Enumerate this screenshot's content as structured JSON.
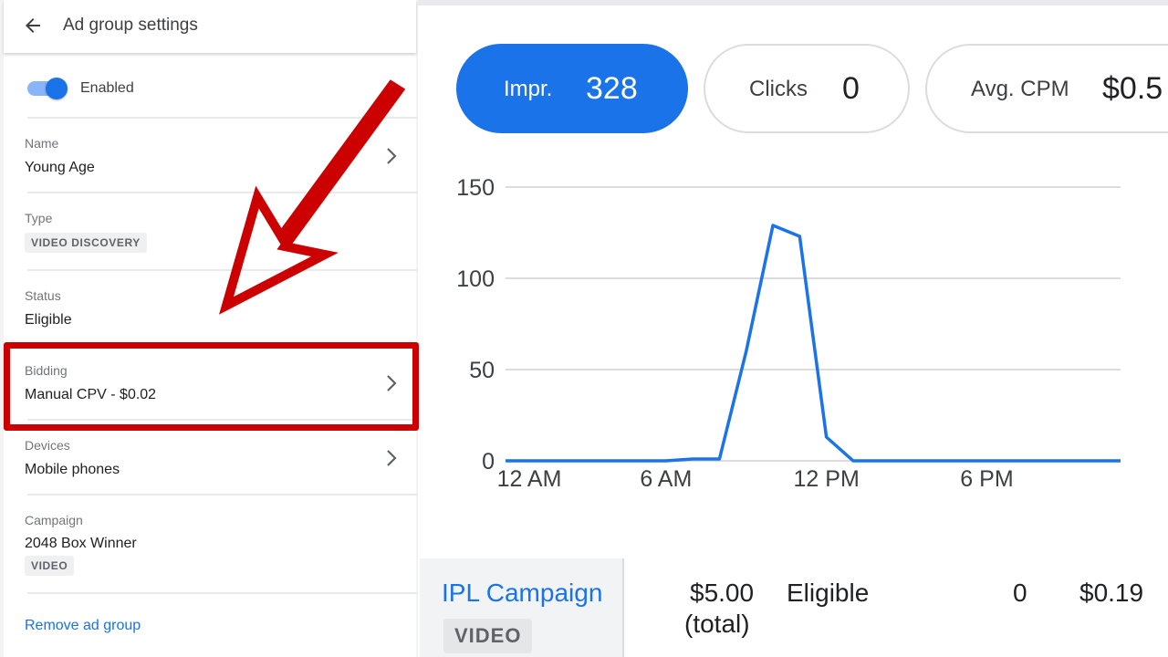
{
  "header": {
    "title": "Ad group settings",
    "back_icon": "arrow-back-icon"
  },
  "status_toggle": {
    "label": "Enabled",
    "on": true
  },
  "fields": {
    "name": {
      "label": "Name",
      "value": "Young Age"
    },
    "type": {
      "label": "Type",
      "chip": "VIDEO DISCOVERY"
    },
    "status": {
      "label": "Status",
      "value": "Eligible"
    },
    "bidding": {
      "label": "Bidding",
      "value": "Manual CPV - $0.02"
    },
    "devices": {
      "label": "Devices",
      "value": "Mobile phones"
    },
    "campaign": {
      "label": "Campaign",
      "value": "2048 Box Winner",
      "chip": "VIDEO"
    }
  },
  "remove_link": "Remove ad group",
  "metrics": [
    {
      "label": "Impr.",
      "value": "328",
      "active": true
    },
    {
      "label": "Clicks",
      "value": "0",
      "active": false
    },
    {
      "label": "Avg. CPM",
      "value": "$0.5",
      "active": false
    }
  ],
  "chart_data": {
    "type": "line",
    "title": "",
    "xlabel": "",
    "ylabel": "",
    "x_ticks": [
      "12 AM",
      "6 AM",
      "12 PM",
      "6 PM"
    ],
    "y_ticks": [
      0,
      50,
      100,
      150
    ],
    "ylim": [
      0,
      150
    ],
    "xlim": [
      0,
      23
    ],
    "grid": true,
    "series": [
      {
        "x": [
          0,
          1,
          2,
          3,
          4,
          5,
          6,
          7,
          8,
          9,
          10,
          11,
          12,
          13,
          14,
          15,
          16,
          17,
          18,
          19,
          20,
          21,
          22,
          23
        ],
        "y": [
          0,
          0,
          0,
          0,
          0,
          0,
          0,
          1,
          1,
          60,
          129,
          123,
          13,
          0,
          0,
          0,
          0,
          0,
          0,
          0,
          0,
          0,
          0,
          0
        ]
      }
    ],
    "colors": {
      "line": "#1a73e8",
      "grid": "#dadce0"
    }
  },
  "table_row": {
    "campaign_name": "IPL Campaign",
    "campaign_type": "VIDEO",
    "budget_line1": "$5.00",
    "budget_line2": "(total)",
    "status": "Eligible",
    "clicks": "0",
    "cost": "$0.19"
  },
  "colors": {
    "accent": "#1a73e8",
    "annotation_red": "#cc0000"
  }
}
